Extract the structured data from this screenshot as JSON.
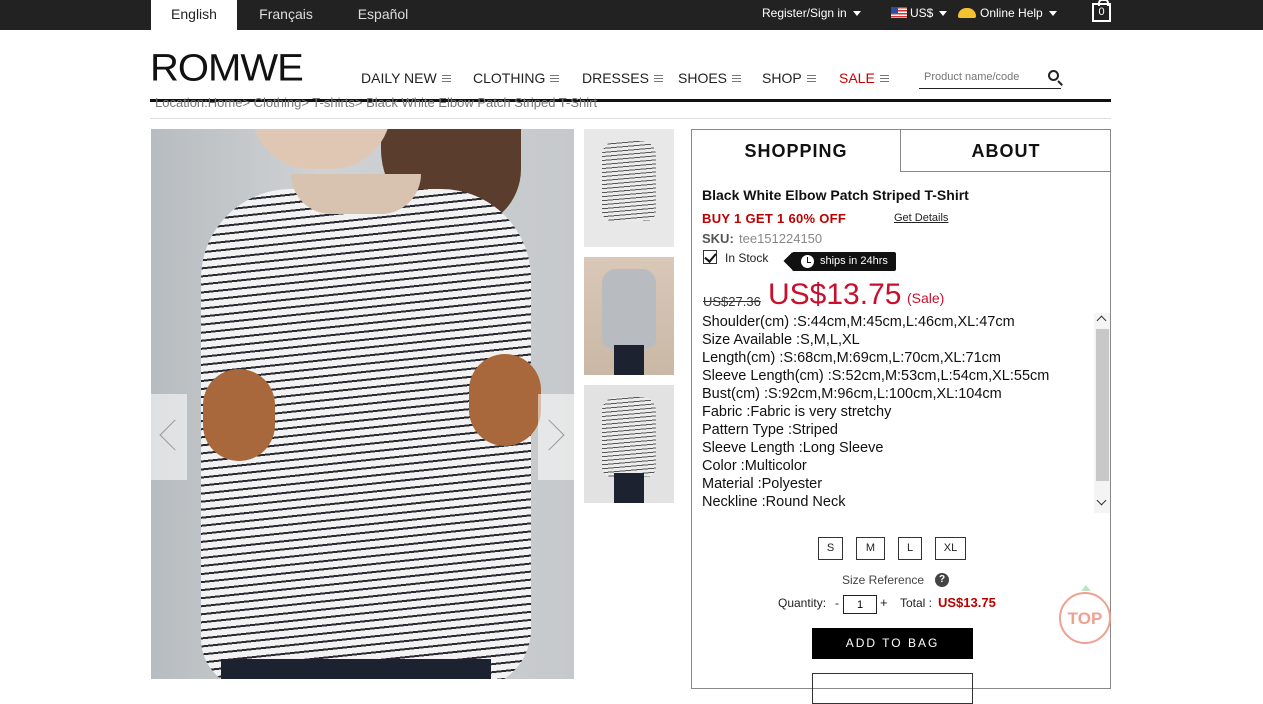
{
  "topbar": {
    "languages": [
      "English",
      "Français",
      "Español"
    ],
    "register": "Register/Sign in",
    "currency": "US$",
    "help": "Online Help",
    "bag_count": "0"
  },
  "header": {
    "logo": "ROMWE",
    "nav": [
      "DAILY NEW",
      "CLOTHING",
      "DRESSES",
      "SHOES",
      "SHOP",
      "SALE"
    ],
    "search_placeholder": "Product name/code"
  },
  "breadcrumb": "Location:Home> Clothing> T-shirts> Black White Elbow Patch Striped T-Shirt",
  "tabs": [
    "SHOPPING",
    "ABOUT"
  ],
  "product": {
    "title": "Black White Elbow Patch Striped T-Shirt",
    "promo": "BUY 1 GET 1 60% OFF",
    "promo_link": "Get Details",
    "sku_label": "SKU:",
    "sku": "tee151224150",
    "stock": "In Stock",
    "ships": "ships in 24hrs",
    "old_price": "US$27.36",
    "price": "US$13.75",
    "sale_label": "(Sale)",
    "specs": [
      "Shoulder(cm) :S:44cm,M:45cm,L:46cm,XL:47cm",
      "Size Available :S,M,L,XL",
      "Length(cm) :S:68cm,M:69cm,L:70cm,XL:71cm",
      "Sleeve Length(cm) :S:52cm,M:53cm,L:54cm,XL:55cm",
      "Bust(cm) :S:92cm,M:96cm,L:100cm,XL:104cm",
      "Fabric :Fabric is very stretchy",
      "Pattern Type :Striped",
      "Sleeve Length :Long Sleeve",
      "Color :Multicolor",
      "Material :Polyester",
      "Neckline :Round Neck"
    ],
    "sizes": [
      "S",
      "M",
      "L",
      "XL"
    ],
    "size_reference": "Size Reference",
    "quantity_label": "Quantity:",
    "quantity": "1",
    "total_label": "Total :",
    "total": "US$13.75",
    "add_to_bag": "ADD TO BAG"
  },
  "top_button": "TOP",
  "colors": {
    "accent": "#c8102e",
    "topbar": "#222222"
  }
}
